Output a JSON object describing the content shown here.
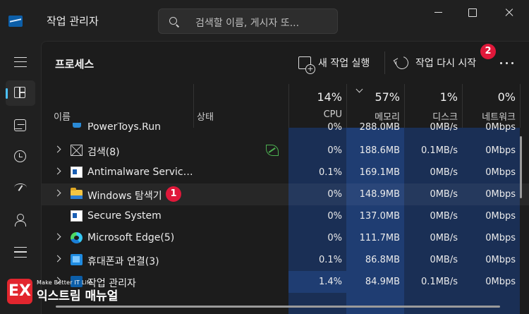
{
  "window": {
    "title": "작업 관리자",
    "search_placeholder": "검색할 이름, 게시자 또..."
  },
  "nav": {
    "items": [
      {
        "name": "menu",
        "icon": "hamburger-icon"
      },
      {
        "name": "processes",
        "icon": "processes-icon",
        "active": true
      },
      {
        "name": "performance",
        "icon": "performance-icon"
      },
      {
        "name": "app-history",
        "icon": "history-icon"
      },
      {
        "name": "startup-apps",
        "icon": "startup-icon"
      },
      {
        "name": "users",
        "icon": "users-icon"
      },
      {
        "name": "details",
        "icon": "details-icon"
      }
    ]
  },
  "toolbar": {
    "page_title": "프로세스",
    "new_task_label": "새 작업 실행",
    "restart_task_label": "작업 다시 시작",
    "badge_restart": "2"
  },
  "columns": {
    "name": "이름",
    "status": "상태",
    "cpu": {
      "label": "CPU",
      "percent": "14%"
    },
    "memory": {
      "label": "메모리",
      "percent": "57%"
    },
    "disk": {
      "label": "디스크",
      "percent": "1%"
    },
    "network": {
      "label": "네트워크",
      "percent": "0%"
    }
  },
  "rows": [
    {
      "name": "PowerToys.Run",
      "cpu": "0%",
      "memory": "288.0MB",
      "disk": "0MB/s",
      "network": "0Mbps",
      "expandable": false,
      "icon": "powertoys-icon"
    },
    {
      "name": "검색(8)",
      "cpu": "0%",
      "memory": "188.6MB",
      "disk": "0.1MB/s",
      "network": "0Mbps",
      "expandable": true,
      "icon": "generic-app-icon",
      "eco": true
    },
    {
      "name": "Antimalware Service Executable",
      "cpu": "0.1%",
      "memory": "169.1MB",
      "disk": "0MB/s",
      "network": "0Mbps",
      "expandable": true,
      "icon": "window-app-icon"
    },
    {
      "name": "Windows 탐색기",
      "cpu": "0%",
      "memory": "148.9MB",
      "disk": "0MB/s",
      "network": "0Mbps",
      "expandable": true,
      "icon": "folder-icon",
      "selected": true,
      "badge": "1"
    },
    {
      "name": "Secure System",
      "cpu": "0%",
      "memory": "137.0MB",
      "disk": "0MB/s",
      "network": "0Mbps",
      "expandable": false,
      "icon": "window-app-icon"
    },
    {
      "name": "Microsoft Edge(5)",
      "cpu": "0%",
      "memory": "111.7MB",
      "disk": "0MB/s",
      "network": "0Mbps",
      "expandable": true,
      "icon": "edge-icon"
    },
    {
      "name": "휴대폰과 연결(3)",
      "cpu": "0.1%",
      "memory": "86.8MB",
      "disk": "0MB/s",
      "network": "0Mbps",
      "expandable": true,
      "icon": "phone-link-icon"
    },
    {
      "name": "작업 관리자",
      "cpu": "1.4%",
      "memory": "84.9MB",
      "disk": "0.1MB/s",
      "network": "0Mbps",
      "expandable": true,
      "icon": "task-manager-icon"
    }
  ],
  "watermark": {
    "mark": "EX",
    "tagline": "Make Better IT Life",
    "name": "익스트림 매뉴얼"
  },
  "colors": {
    "accent": "#4cc2ff",
    "badge": "#e0183a",
    "heat_low": "#1d3557",
    "heat_cpu": "#1e3a6b",
    "heat_mem": "#21457f"
  }
}
